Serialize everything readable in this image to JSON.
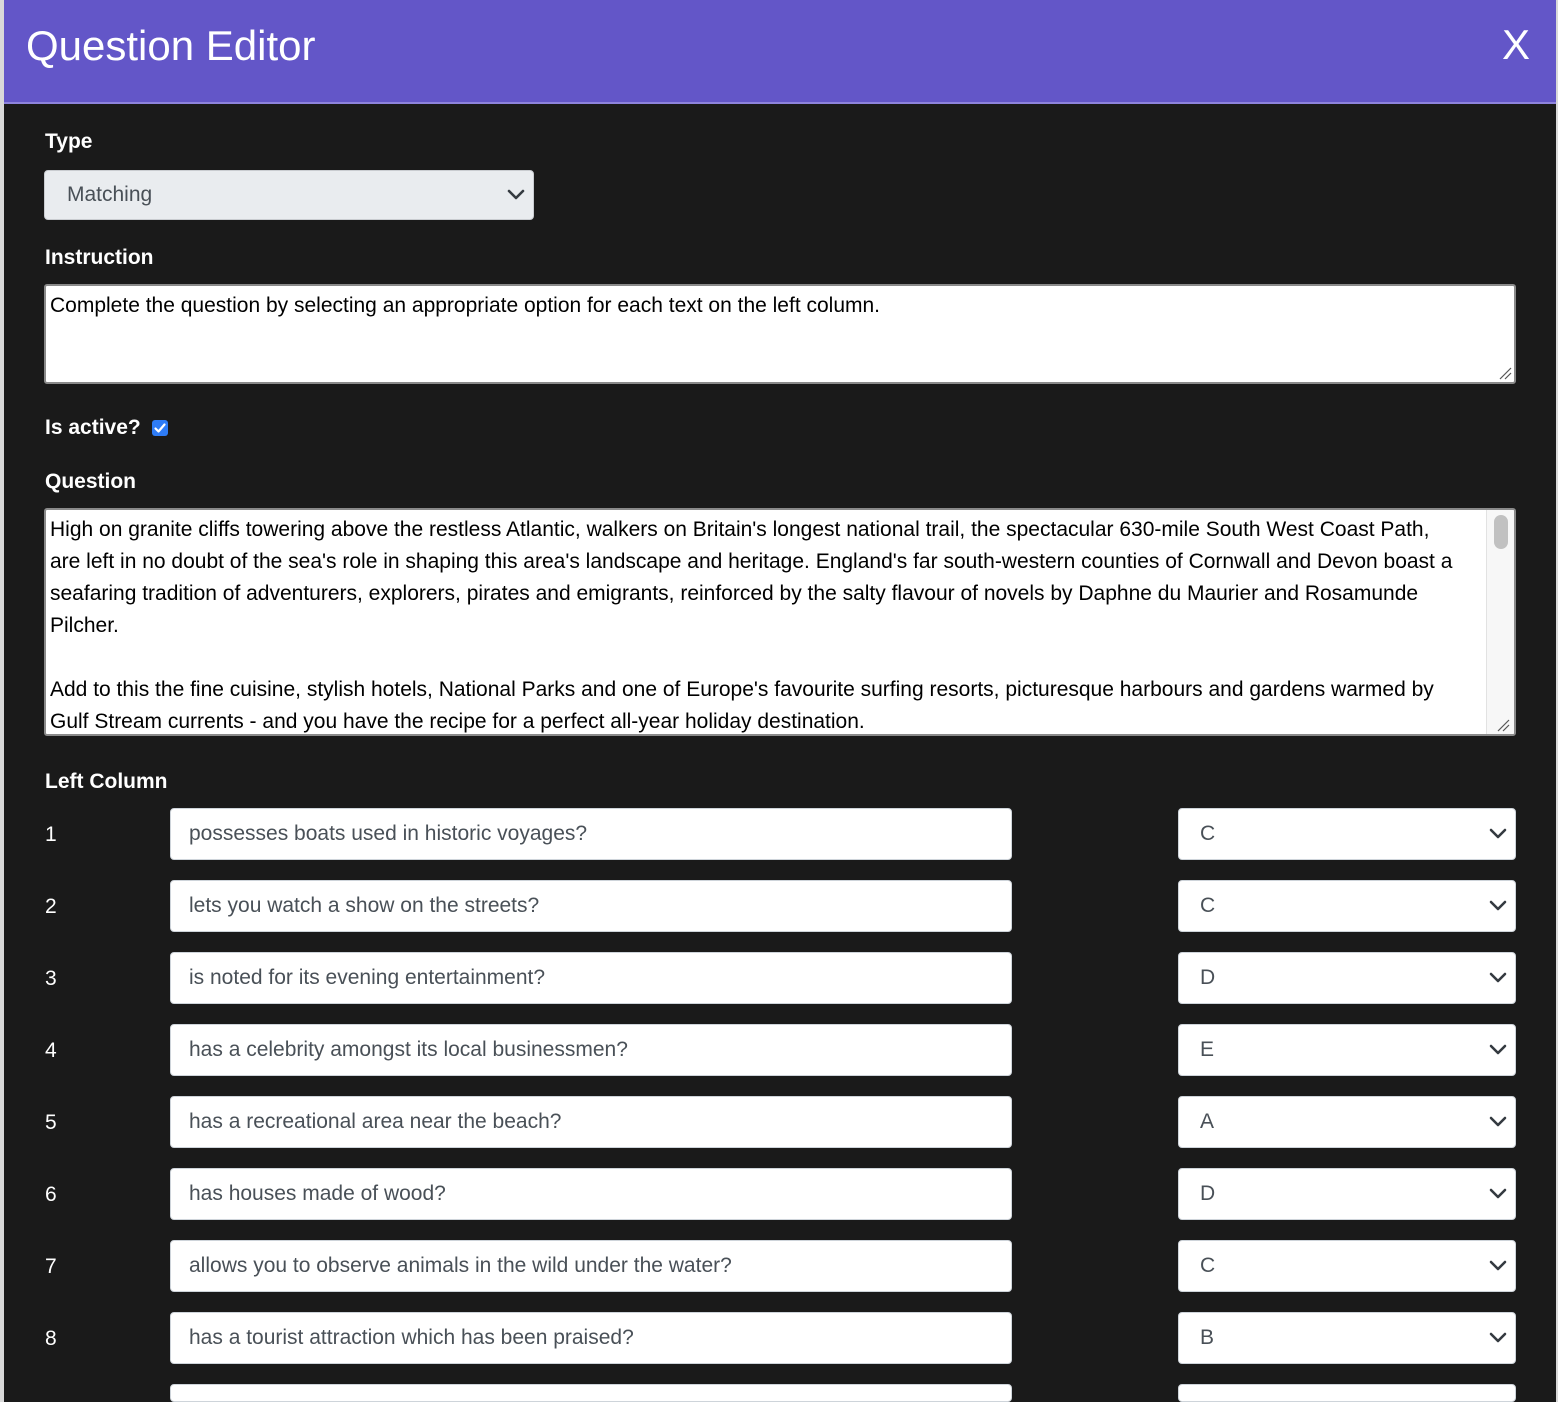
{
  "header": {
    "title": "Question Editor",
    "close_label": "X"
  },
  "type": {
    "label": "Type",
    "selected": "Matching"
  },
  "instruction": {
    "label": "Instruction",
    "value": "Complete the question by selecting an appropriate option for each text on the left column."
  },
  "active": {
    "label": "Is active?",
    "checked": true
  },
  "question": {
    "label": "Question",
    "lines": [
      "High on granite cliffs towering above the restless Atlantic, walkers on Britain's longest national trail, the spectacular 630-mile South West Coast Path,",
      "are left in no doubt of the sea's role in shaping this area's landscape and heritage. England's far south-western counties of Cornwall and Devon boast a",
      "seafaring tradition of adventurers, explorers, pirates and emigrants, reinforced by the salty flavour of novels by Daphne du Maurier and Rosamunde",
      "Pilcher.",
      "",
      "Add to this the fine cuisine, stylish hotels, National Parks and one of Europe's favourite surfing resorts, picturesque harbours and gardens warmed by",
      "Gulf Stream currents - and you have the recipe for a perfect all-year holiday destination."
    ]
  },
  "left_column": {
    "label": "Left Column",
    "rows": [
      {
        "num": "1",
        "text": "possesses boats used in historic voyages?",
        "answer": "C"
      },
      {
        "num": "2",
        "text": "lets you watch a show on the streets?",
        "answer": "C"
      },
      {
        "num": "3",
        "text": "is noted for its evening entertainment?",
        "answer": "D"
      },
      {
        "num": "4",
        "text": "has a celebrity amongst its local businessmen?",
        "answer": "E"
      },
      {
        "num": "5",
        "text": "has a recreational area near the beach?",
        "answer": "A"
      },
      {
        "num": "6",
        "text": "has houses made of wood?",
        "answer": "D"
      },
      {
        "num": "7",
        "text": "allows you to observe animals in the wild under the water?",
        "answer": "C"
      },
      {
        "num": "8",
        "text": "has a tourist attraction which has been praised?",
        "answer": "B"
      },
      {
        "num": "",
        "text": "",
        "answer": ""
      }
    ]
  }
}
